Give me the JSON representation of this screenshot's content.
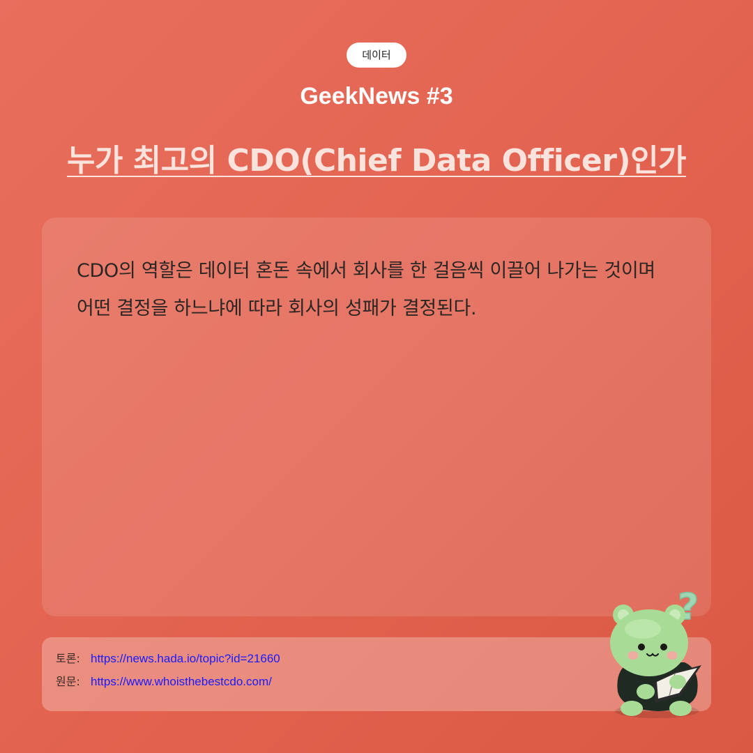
{
  "category_badge": "데이터",
  "brand_title": "GeekNews #3",
  "headline": "누가 최고의 CDO(Chief Data Officer)인가",
  "summary": "CDO의 역할은 데이터 혼돈 속에서 회사를 한 걸음씩 이끌어 나가는 것이며 어떤 결정을 하느냐에 따라 회사의 성패가 결정된다.",
  "links": {
    "discussion_label": "토론:",
    "discussion_url": "https://news.hada.io/topic?id=21660",
    "original_label": "원문:",
    "original_url": "https://www.whoisthebestcdo.com/"
  },
  "colors": {
    "background": "#e2624f",
    "badge_bg": "#ffffff",
    "headline": "#fbe3dd",
    "link": "#1a1aff",
    "mascot_body": "#a8dc96"
  },
  "mascot": {
    "icon": "bear-reading-book-icon",
    "question_mark": "?"
  }
}
